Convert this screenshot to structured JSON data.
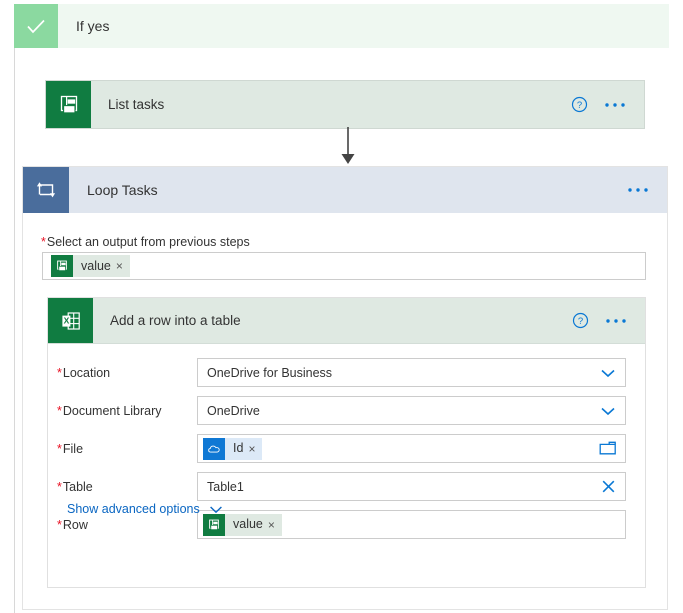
{
  "branch": {
    "label": "If yes",
    "icon": "check-icon",
    "header_bg": "#eff8f1",
    "icon_bg": "#8bd9a0"
  },
  "list_tasks_card": {
    "title": "List tasks",
    "icon": "planner-icon",
    "icon_bg": "#107c41",
    "card_bg": "#dfe9e2",
    "actions": [
      "help-icon",
      "more-options-icon"
    ]
  },
  "connector": {
    "icon": "arrow-down-icon",
    "color": "#444444"
  },
  "loop": {
    "title": "Loop Tasks",
    "icon": "loop-icon",
    "icon_bg": "#4a6d9c",
    "header_bg": "#dfe5ee",
    "actions": [
      "more-options-icon"
    ],
    "select_output": {
      "required": "*",
      "label": "Select an output from previous steps",
      "token": {
        "text": "value",
        "icon": "planner-icon",
        "icon_bg": "#107c41",
        "remove": "×"
      }
    }
  },
  "excel_action": {
    "title": "Add a row into a table",
    "icon": "excel-icon",
    "icon_bg": "#107c41",
    "header_bg": "#dfe9e2",
    "actions": [
      "help-icon",
      "more-options-icon"
    ],
    "fields": [
      {
        "required": "*",
        "label": "Location",
        "type": "dropdown",
        "value": "OneDrive for Business",
        "affordance": "chevron-down-icon"
      },
      {
        "required": "*",
        "label": "Document Library",
        "type": "dropdown",
        "value": "OneDrive",
        "affordance": "chevron-down-icon"
      },
      {
        "required": "*",
        "label": "File",
        "type": "token",
        "token": {
          "text": "Id",
          "icon": "onedrive-icon",
          "icon_bg": "#0f78d4",
          "remove": "×"
        },
        "affordance": "folder-picker-icon"
      },
      {
        "required": "*",
        "label": "Table",
        "type": "text",
        "value": "Table1",
        "affordance": "clear-icon"
      },
      {
        "required": "*",
        "label": "Row",
        "type": "token",
        "token": {
          "text": "value",
          "icon": "planner-icon",
          "icon_bg": "#107c41",
          "remove": "×"
        },
        "affordance": ""
      }
    ],
    "advanced_options": {
      "label": "Show advanced options",
      "icon": "chevron-down-icon",
      "color": "#0a66c2"
    }
  },
  "colors": {
    "accent_blue": "#0a66c2",
    "required_red": "#e81123",
    "planner_green": "#107c41",
    "loop_blue": "#4a6d9c"
  }
}
